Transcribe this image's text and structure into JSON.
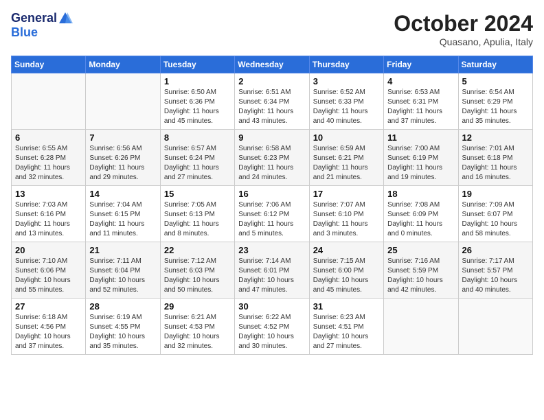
{
  "logo": {
    "line1": "General",
    "line2": "Blue"
  },
  "title": "October 2024",
  "location": "Quasano, Apulia, Italy",
  "days_of_week": [
    "Sunday",
    "Monday",
    "Tuesday",
    "Wednesday",
    "Thursday",
    "Friday",
    "Saturday"
  ],
  "weeks": [
    [
      {
        "day": "",
        "sunrise": "",
        "sunset": "",
        "daylight": ""
      },
      {
        "day": "",
        "sunrise": "",
        "sunset": "",
        "daylight": ""
      },
      {
        "day": "1",
        "sunrise": "Sunrise: 6:50 AM",
        "sunset": "Sunset: 6:36 PM",
        "daylight": "Daylight: 11 hours and 45 minutes."
      },
      {
        "day": "2",
        "sunrise": "Sunrise: 6:51 AM",
        "sunset": "Sunset: 6:34 PM",
        "daylight": "Daylight: 11 hours and 43 minutes."
      },
      {
        "day": "3",
        "sunrise": "Sunrise: 6:52 AM",
        "sunset": "Sunset: 6:33 PM",
        "daylight": "Daylight: 11 hours and 40 minutes."
      },
      {
        "day": "4",
        "sunrise": "Sunrise: 6:53 AM",
        "sunset": "Sunset: 6:31 PM",
        "daylight": "Daylight: 11 hours and 37 minutes."
      },
      {
        "day": "5",
        "sunrise": "Sunrise: 6:54 AM",
        "sunset": "Sunset: 6:29 PM",
        "daylight": "Daylight: 11 hours and 35 minutes."
      }
    ],
    [
      {
        "day": "6",
        "sunrise": "Sunrise: 6:55 AM",
        "sunset": "Sunset: 6:28 PM",
        "daylight": "Daylight: 11 hours and 32 minutes."
      },
      {
        "day": "7",
        "sunrise": "Sunrise: 6:56 AM",
        "sunset": "Sunset: 6:26 PM",
        "daylight": "Daylight: 11 hours and 29 minutes."
      },
      {
        "day": "8",
        "sunrise": "Sunrise: 6:57 AM",
        "sunset": "Sunset: 6:24 PM",
        "daylight": "Daylight: 11 hours and 27 minutes."
      },
      {
        "day": "9",
        "sunrise": "Sunrise: 6:58 AM",
        "sunset": "Sunset: 6:23 PM",
        "daylight": "Daylight: 11 hours and 24 minutes."
      },
      {
        "day": "10",
        "sunrise": "Sunrise: 6:59 AM",
        "sunset": "Sunset: 6:21 PM",
        "daylight": "Daylight: 11 hours and 21 minutes."
      },
      {
        "day": "11",
        "sunrise": "Sunrise: 7:00 AM",
        "sunset": "Sunset: 6:19 PM",
        "daylight": "Daylight: 11 hours and 19 minutes."
      },
      {
        "day": "12",
        "sunrise": "Sunrise: 7:01 AM",
        "sunset": "Sunset: 6:18 PM",
        "daylight": "Daylight: 11 hours and 16 minutes."
      }
    ],
    [
      {
        "day": "13",
        "sunrise": "Sunrise: 7:03 AM",
        "sunset": "Sunset: 6:16 PM",
        "daylight": "Daylight: 11 hours and 13 minutes."
      },
      {
        "day": "14",
        "sunrise": "Sunrise: 7:04 AM",
        "sunset": "Sunset: 6:15 PM",
        "daylight": "Daylight: 11 hours and 11 minutes."
      },
      {
        "day": "15",
        "sunrise": "Sunrise: 7:05 AM",
        "sunset": "Sunset: 6:13 PM",
        "daylight": "Daylight: 11 hours and 8 minutes."
      },
      {
        "day": "16",
        "sunrise": "Sunrise: 7:06 AM",
        "sunset": "Sunset: 6:12 PM",
        "daylight": "Daylight: 11 hours and 5 minutes."
      },
      {
        "day": "17",
        "sunrise": "Sunrise: 7:07 AM",
        "sunset": "Sunset: 6:10 PM",
        "daylight": "Daylight: 11 hours and 3 minutes."
      },
      {
        "day": "18",
        "sunrise": "Sunrise: 7:08 AM",
        "sunset": "Sunset: 6:09 PM",
        "daylight": "Daylight: 11 hours and 0 minutes."
      },
      {
        "day": "19",
        "sunrise": "Sunrise: 7:09 AM",
        "sunset": "Sunset: 6:07 PM",
        "daylight": "Daylight: 10 hours and 58 minutes."
      }
    ],
    [
      {
        "day": "20",
        "sunrise": "Sunrise: 7:10 AM",
        "sunset": "Sunset: 6:06 PM",
        "daylight": "Daylight: 10 hours and 55 minutes."
      },
      {
        "day": "21",
        "sunrise": "Sunrise: 7:11 AM",
        "sunset": "Sunset: 6:04 PM",
        "daylight": "Daylight: 10 hours and 52 minutes."
      },
      {
        "day": "22",
        "sunrise": "Sunrise: 7:12 AM",
        "sunset": "Sunset: 6:03 PM",
        "daylight": "Daylight: 10 hours and 50 minutes."
      },
      {
        "day": "23",
        "sunrise": "Sunrise: 7:14 AM",
        "sunset": "Sunset: 6:01 PM",
        "daylight": "Daylight: 10 hours and 47 minutes."
      },
      {
        "day": "24",
        "sunrise": "Sunrise: 7:15 AM",
        "sunset": "Sunset: 6:00 PM",
        "daylight": "Daylight: 10 hours and 45 minutes."
      },
      {
        "day": "25",
        "sunrise": "Sunrise: 7:16 AM",
        "sunset": "Sunset: 5:59 PM",
        "daylight": "Daylight: 10 hours and 42 minutes."
      },
      {
        "day": "26",
        "sunrise": "Sunrise: 7:17 AM",
        "sunset": "Sunset: 5:57 PM",
        "daylight": "Daylight: 10 hours and 40 minutes."
      }
    ],
    [
      {
        "day": "27",
        "sunrise": "Sunrise: 6:18 AM",
        "sunset": "Sunset: 4:56 PM",
        "daylight": "Daylight: 10 hours and 37 minutes."
      },
      {
        "day": "28",
        "sunrise": "Sunrise: 6:19 AM",
        "sunset": "Sunset: 4:55 PM",
        "daylight": "Daylight: 10 hours and 35 minutes."
      },
      {
        "day": "29",
        "sunrise": "Sunrise: 6:21 AM",
        "sunset": "Sunset: 4:53 PM",
        "daylight": "Daylight: 10 hours and 32 minutes."
      },
      {
        "day": "30",
        "sunrise": "Sunrise: 6:22 AM",
        "sunset": "Sunset: 4:52 PM",
        "daylight": "Daylight: 10 hours and 30 minutes."
      },
      {
        "day": "31",
        "sunrise": "Sunrise: 6:23 AM",
        "sunset": "Sunset: 4:51 PM",
        "daylight": "Daylight: 10 hours and 27 minutes."
      },
      {
        "day": "",
        "sunrise": "",
        "sunset": "",
        "daylight": ""
      },
      {
        "day": "",
        "sunrise": "",
        "sunset": "",
        "daylight": ""
      }
    ]
  ]
}
